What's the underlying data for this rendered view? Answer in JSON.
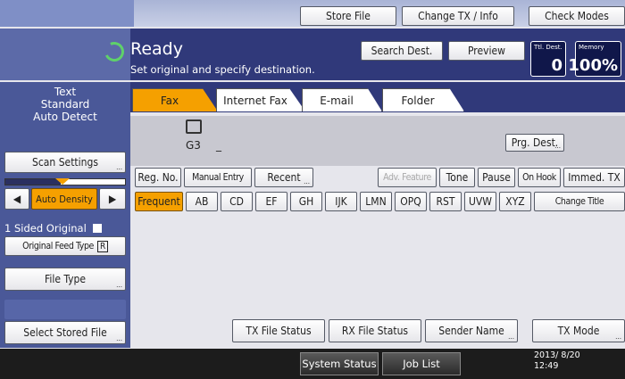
{
  "topbar": {
    "store_file": "Store File",
    "change_tx": "Change TX / Info",
    "check_modes": "Check Modes"
  },
  "status": {
    "ready": "Ready",
    "message": "Set original and specify destination.",
    "search_dest": "Search Dest.",
    "preview": "Preview",
    "ttl_dest_label": "Ttl. Dest.",
    "ttl_dest_value": "0",
    "memory_label": "Memory",
    "memory_value": "100%"
  },
  "left": {
    "mode_lines": [
      "Text",
      "Standard",
      "Auto Detect"
    ],
    "scan_settings": "Scan Settings",
    "auto_density": "Auto Density",
    "sided": "1 Sided Original",
    "feed_type": "Original Feed Type",
    "file_type": "File Type",
    "select_stored": "Select Stored File"
  },
  "tabs": [
    "Fax",
    "Internet Fax",
    "E-mail",
    "Folder"
  ],
  "dest": {
    "line": "G3",
    "cursor": "_",
    "prg_dest": "Prg. Dest."
  },
  "row1": [
    "Reg. No.",
    "Manual Entry",
    "Recent",
    "Adv. Feature",
    "Tone",
    "Pause",
    "On Hook",
    "Immed. TX"
  ],
  "row2": [
    "Frequent",
    "AB",
    "CD",
    "EF",
    "GH",
    "IJK",
    "LMN",
    "OPQ",
    "RST",
    "UVW",
    "XYZ",
    "Change Title"
  ],
  "bottom": {
    "tx_status": "TX File Status",
    "rx_status": "RX File Status",
    "sender": "Sender Name",
    "tx_mode": "TX Mode"
  },
  "footer": {
    "system_status": "System Status",
    "job_list": "Job List",
    "date": "2013/ 8/20",
    "time": "12:49"
  },
  "colors": {
    "accent": "#f5a000",
    "header_dark": "#30397a",
    "panel": "#4a5898"
  }
}
